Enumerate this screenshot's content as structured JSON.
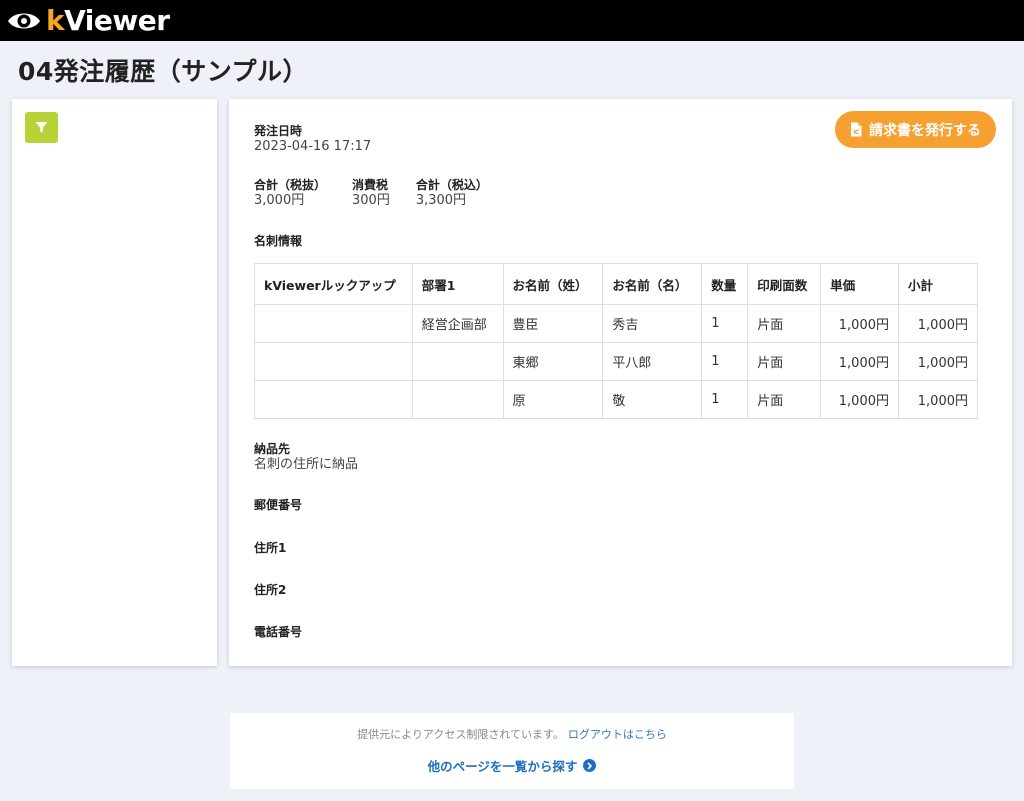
{
  "app": {
    "logo_k": "k",
    "logo_rest": "Viewer"
  },
  "page_title": "04発注履歴（サンプル）",
  "invoice_button_label": "請求書を発行する",
  "order": {
    "date_label": "発注日時",
    "date_value": "2023-04-16 17:17",
    "totals": [
      {
        "label": "合計（税抜）",
        "value": "3,000円"
      },
      {
        "label": "消費税",
        "value": "300円"
      },
      {
        "label": "合計（税込）",
        "value": "3,300円"
      }
    ]
  },
  "card_info": {
    "label": "名刺情報",
    "headers": [
      "kViewerルックアップ",
      "部署1",
      "お名前（姓）",
      "お名前（名）",
      "数量",
      "印刷面数",
      "単価",
      "小計"
    ],
    "rows": [
      [
        "",
        "経営企画部",
        "豊臣",
        "秀吉",
        "1",
        "片面",
        "1,000円",
        "1,000円"
      ],
      [
        "",
        "",
        "東郷",
        "平八郎",
        "1",
        "片面",
        "1,000円",
        "1,000円"
      ],
      [
        "",
        "",
        "原",
        "敬",
        "1",
        "片面",
        "1,000円",
        "1,000円"
      ]
    ]
  },
  "delivery": {
    "label": "納品先",
    "value": "名刺の住所に納品"
  },
  "fields": {
    "postal_label": "郵便番号",
    "address1_label": "住所1",
    "address2_label": "住所2",
    "phone_label": "電話番号"
  },
  "footer": {
    "access_note": "提供元によりアクセス制限されています。",
    "logout_link": "ログアウトはこちら",
    "other_pages_link": "他のページを一覧から探す"
  },
  "colors": {
    "topbar": "#000000",
    "logo_accent": "#f5a623",
    "filter_button": "#b5d334",
    "invoice_button": "#f6a032",
    "link": "#1f6fbf",
    "background": "#eef1f8"
  }
}
